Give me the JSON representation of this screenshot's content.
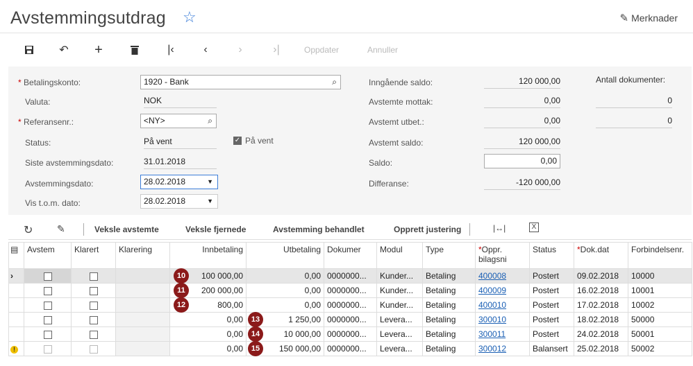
{
  "header": {
    "title": "Avstemmingsutdrag",
    "notes_label": "Merknader"
  },
  "toolbar": {
    "refresh_label": "Oppdater",
    "cancel_label": "Annuller"
  },
  "form": {
    "bank_account_label": "Betalingskonto:",
    "bank_account_value": "1920 - Bank",
    "currency_label": "Valuta:",
    "currency_value": "NOK",
    "ref_label": "Referansenr.:",
    "ref_value": "<NY>",
    "status_label": "Status:",
    "status_value": "På vent",
    "on_hold_label": "På vent",
    "last_date_label": "Siste avstemmingsdato:",
    "last_date_value": "31.01.2018",
    "recon_date_label": "Avstemmingsdato:",
    "recon_date_value": "28.02.2018",
    "show_to_label": "Vis t.o.m. dato:",
    "show_to_value": "28.02.2018",
    "opening_label": "Inngående saldo:",
    "opening_value": "120 000,00",
    "recv_label": "Avstemte mottak:",
    "recv_value": "0,00",
    "disb_label": "Avstemt utbet.:",
    "disb_value": "0,00",
    "recon_bal_label": "Avstemt saldo:",
    "recon_bal_value": "120 000,00",
    "balance_label": "Saldo:",
    "balance_value": "0,00",
    "diff_label": "Differanse:",
    "diff_value": "-120 000,00",
    "doc_count_label": "Antall dokumenter:",
    "doc_count_1": "0",
    "doc_count_2": "0"
  },
  "grid_toolbar": {
    "toggle_recon": "Veksle avstemte",
    "toggle_removed": "Veksle fjernede",
    "recon_done": "Avstemming behandlet",
    "create_adj": "Opprett justering"
  },
  "columns": [
    "Avstem",
    "Klarert",
    "Klarering",
    "Innbetaling",
    "Utbetaling",
    "Dokumer",
    "Modul",
    "Type",
    "Oppr. bilagsni",
    "Status",
    "Dok.dat",
    "Forbindelsenr."
  ],
  "rows": [
    {
      "badge": "10",
      "in": "100 000,00",
      "out": "0,00",
      "doc": "0000000...",
      "mod": "Kunder...",
      "type": "Betaling",
      "ref": "400008",
      "status": "Postert",
      "date": "09.02.2018",
      "bp": "10000"
    },
    {
      "badge": "11",
      "in": "200 000,00",
      "out": "0,00",
      "doc": "0000000...",
      "mod": "Kunder...",
      "type": "Betaling",
      "ref": "400009",
      "status": "Postert",
      "date": "16.02.2018",
      "bp": "10001"
    },
    {
      "badge": "12",
      "in": "800,00",
      "out": "0,00",
      "doc": "0000000...",
      "mod": "Kunder...",
      "type": "Betaling",
      "ref": "400010",
      "status": "Postert",
      "date": "17.02.2018",
      "bp": "10002"
    },
    {
      "badge": "13",
      "in": "0,00",
      "out": "1 250,00",
      "doc": "0000000...",
      "mod": "Levera...",
      "type": "Betaling",
      "ref": "300010",
      "status": "Postert",
      "date": "18.02.2018",
      "bp": "50000"
    },
    {
      "badge": "14",
      "in": "0,00",
      "out": "10 000,00",
      "doc": "0000000...",
      "mod": "Levera...",
      "type": "Betaling",
      "ref": "300011",
      "status": "Postert",
      "date": "24.02.2018",
      "bp": "50001"
    },
    {
      "badge": "15",
      "in": "0,00",
      "out": "150 000,00",
      "doc": "0000000...",
      "mod": "Levera...",
      "type": "Betaling",
      "ref": "300012",
      "status": "Balansert",
      "date": "25.02.2018",
      "bp": "50002"
    }
  ]
}
